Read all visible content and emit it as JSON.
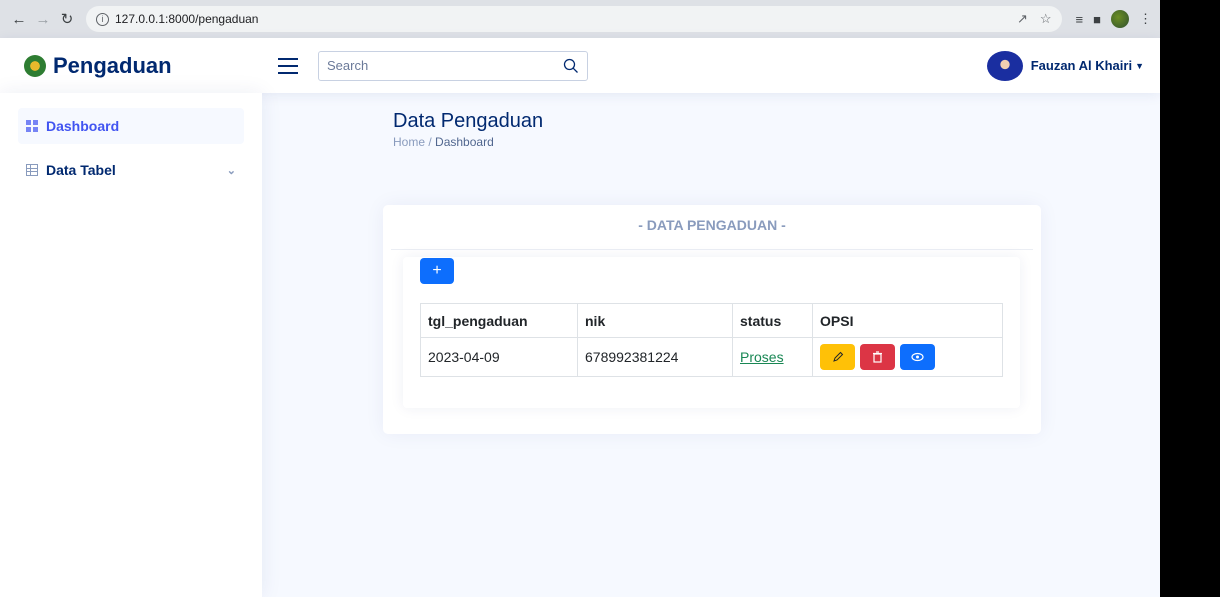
{
  "browser": {
    "url": "127.0.0.1:8000/pengaduan"
  },
  "header": {
    "brand": "Pengaduan",
    "search_placeholder": "Search",
    "user_name": "Fauzan Al Khairi"
  },
  "sidebar": {
    "items": [
      {
        "label": "Dashboard",
        "icon": "grid-icon",
        "active": true
      },
      {
        "label": "Data Tabel",
        "icon": "table-icon",
        "active": false
      }
    ]
  },
  "main": {
    "page_title": "Data Pengaduan",
    "breadcrumb": {
      "home": "Home",
      "separator": "/",
      "current": "Dashboard"
    },
    "card_title": "- DATA PENGADUAN -",
    "add_button": "+",
    "table": {
      "columns": [
        "tgl_pengaduan",
        "nik",
        "status",
        "OPSI"
      ],
      "rows": [
        {
          "tgl_pengaduan": "2023-04-09",
          "nik": "678992381224",
          "status": "Proses"
        }
      ]
    }
  },
  "colors": {
    "brand": "#012970",
    "primary": "#0d6efd",
    "warning": "#ffc107",
    "danger": "#dc3545",
    "success": "#198754"
  }
}
